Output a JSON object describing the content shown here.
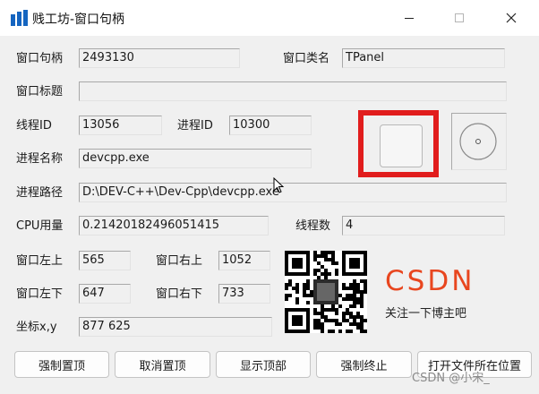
{
  "window": {
    "title": "贱工坊-窗口句柄",
    "minimize_icon": "minimize-icon",
    "maximize_icon": "maximize-icon",
    "close_icon": "close-icon"
  },
  "fields": {
    "handle": {
      "label": "窗口句柄",
      "value": "2493130"
    },
    "class_name": {
      "label": "窗口类名",
      "value": "TPanel"
    },
    "window_title": {
      "label": "窗口标题",
      "value": ""
    },
    "thread_id": {
      "label": "线程ID",
      "value": "13056"
    },
    "process_id": {
      "label": "进程ID",
      "value": "10300"
    },
    "process_name": {
      "label": "进程名称",
      "value": "devcpp.exe"
    },
    "process_path": {
      "label": "进程路径",
      "value": "D:\\DEV-C++\\Dev-Cpp\\devcpp.exe"
    },
    "cpu_usage": {
      "label": "CPU用量",
      "value": "0.21420182496051415"
    },
    "thread_count": {
      "label": "线程数",
      "value": "4"
    },
    "left_top": {
      "label": "窗口左上",
      "value": "565"
    },
    "right_top": {
      "label": "窗口右上",
      "value": "1052"
    },
    "left_bottom": {
      "label": "窗口左下",
      "value": "647"
    },
    "right_bottom": {
      "label": "窗口右下",
      "value": "733"
    },
    "coords": {
      "label": "坐标x,y",
      "value": "877 625"
    }
  },
  "promo": {
    "logo": "CSDN",
    "follow_text": "关注一下博主吧"
  },
  "buttons": {
    "force_top": "强制置顶",
    "cancel_top": "取消置顶",
    "show_top": "显示顶部",
    "force_terminate": "强制终止",
    "open_location": "打开文件所在位置"
  },
  "watermark": "CSDN @小宋_",
  "colors": {
    "highlight_frame": "#e11d1d",
    "csdn_brand": "#e8461f",
    "app_icon": "#1565c0"
  }
}
